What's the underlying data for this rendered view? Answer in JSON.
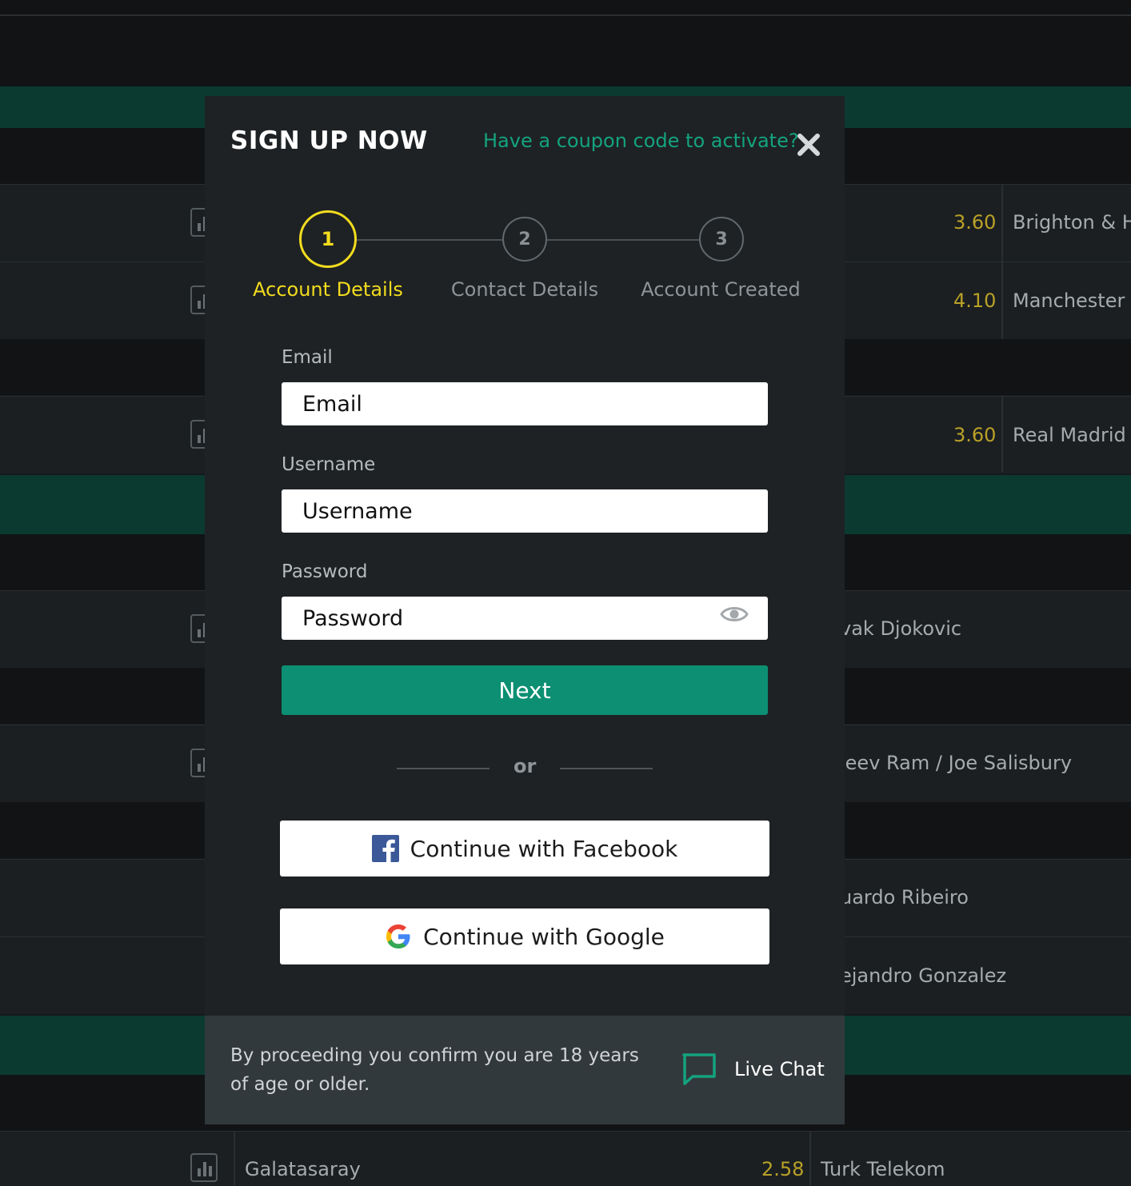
{
  "background": {
    "rows": [
      {
        "odds": "3.60",
        "name": "Brighton & Ho"
      },
      {
        "odds": "4.10",
        "name": "Manchester C"
      },
      {
        "odds": "3.60",
        "name": "Real Madrid"
      },
      {
        "name": "vak Djokovic"
      },
      {
        "name": "jeev Ram / Joe Salisbury"
      },
      {
        "name": "uardo Ribeiro"
      },
      {
        "name": "ejandro Gonzalez"
      }
    ],
    "bottom_row": {
      "home": "Galatasaray",
      "odds": "2.58",
      "away": "Turk Telekom"
    }
  },
  "modal": {
    "title": "SIGN UP NOW",
    "coupon_link": "Have a coupon code to activate?",
    "steps": [
      {
        "number": "1",
        "label": "Account Details",
        "state": "active"
      },
      {
        "number": "2",
        "label": "Contact Details",
        "state": "inactive"
      },
      {
        "number": "3",
        "label": "Account Created",
        "state": "inactive"
      }
    ],
    "fields": {
      "email": {
        "label": "Email",
        "placeholder": "Email",
        "value": ""
      },
      "username": {
        "label": "Username",
        "placeholder": "Username",
        "value": ""
      },
      "password": {
        "label": "Password",
        "placeholder": "Password",
        "value": ""
      }
    },
    "next_label": "Next",
    "or_text": "or",
    "facebook_label": "Continue with Facebook",
    "google_label": "Continue with Google",
    "footer": {
      "age_notice": "By proceeding you confirm you are 18 years of age or older.",
      "live_chat_label": "Live Chat"
    }
  },
  "colors": {
    "accent_green": "#0c8f72",
    "link_green": "#14a37f",
    "step_active": "#f2dc1e",
    "odds_gold": "#b9a128"
  },
  "icons": [
    "close-icon",
    "eye-icon",
    "facebook-icon",
    "google-icon",
    "chat-icon",
    "stats-icon"
  ]
}
